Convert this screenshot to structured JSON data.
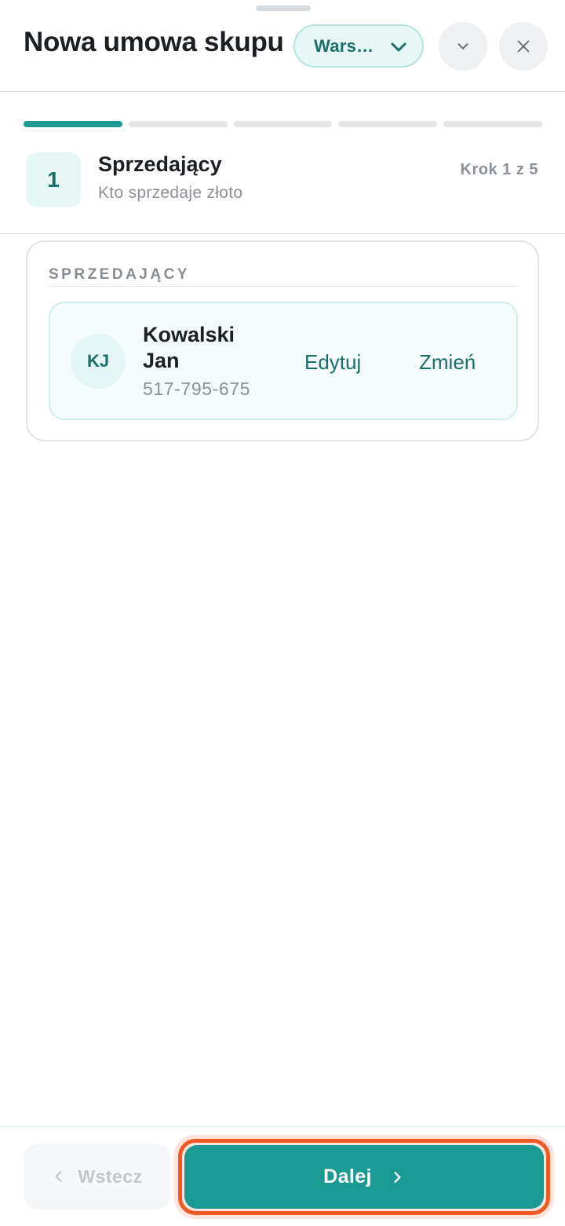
{
  "header": {
    "title": "Nowa umowa skupu",
    "branch_label": "Wars…",
    "icons": {
      "branch_chevron": "chevron-down-icon",
      "collapse": "chevron-down-icon",
      "close": "close-icon"
    }
  },
  "progress": {
    "total_steps": 5,
    "current_step": 1
  },
  "step": {
    "number": "1",
    "title": "Sprzedający",
    "subtitle": "Kto sprzedaje złoto",
    "counter": "Krok 1 z 5"
  },
  "seller_section": {
    "label": "SPRZEDAJĄCY",
    "seller": {
      "initials": "KJ",
      "name": "Kowalski Jan",
      "phone": "517-795-675",
      "edit_label": "Edytuj",
      "change_label": "Zmień"
    }
  },
  "footer": {
    "back_label": "Wstecz",
    "next_label": "Dalej"
  },
  "colors": {
    "accent": "#1a9a93",
    "accent_dark": "#1a6f69",
    "highlight": "#ef5a24"
  }
}
